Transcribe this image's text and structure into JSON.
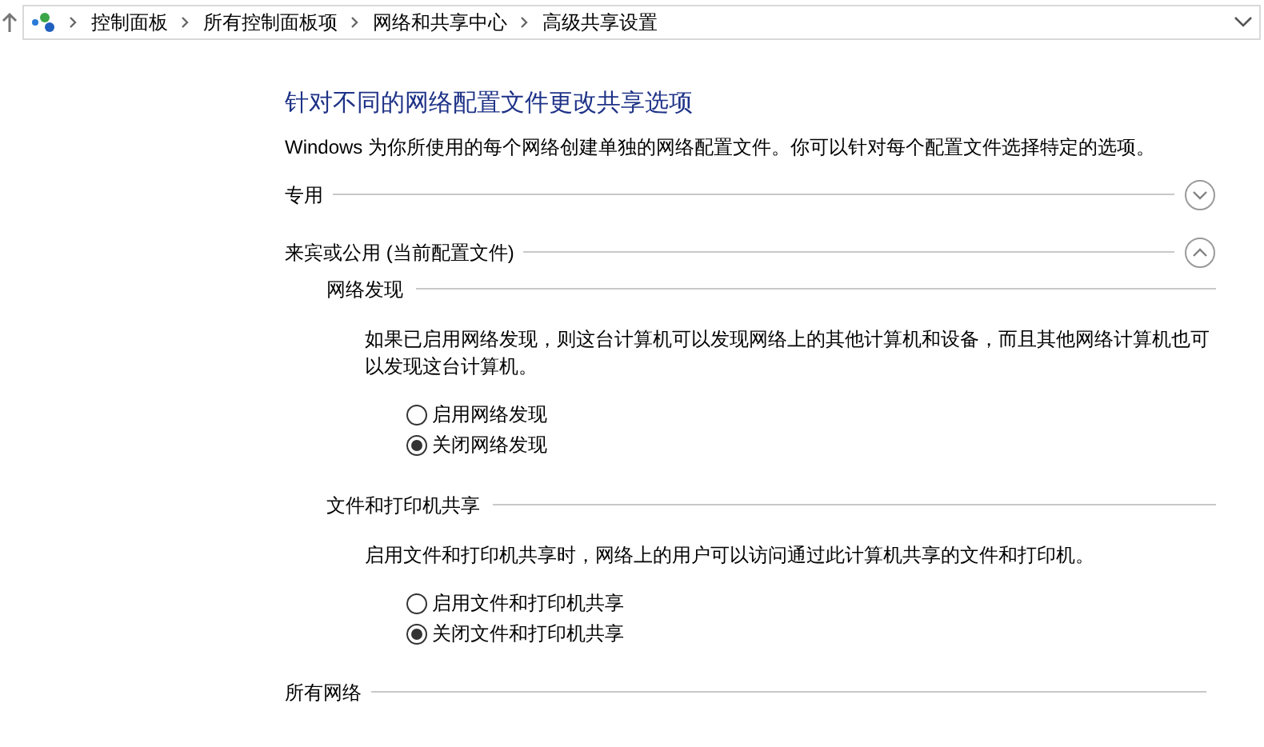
{
  "breadcrumb": [
    "控制面板",
    "所有控制面板项",
    "网络和共享中心",
    "高级共享设置"
  ],
  "title": "针对不同的网络配置文件更改共享选项",
  "description": "Windows 为你所使用的每个网络创建单独的网络配置文件。你可以针对每个配置文件选择特定的选项。",
  "profiles": [
    {
      "label": "专用",
      "expanded": false
    },
    {
      "label": "来宾或公用 (当前配置文件)",
      "expanded": true,
      "sections": [
        {
          "heading": "网络发现",
          "description": "如果已启用网络发现，则这台计算机可以发现网络上的其他计算机和设备，而且其他网络计算机也可以发现这台计算机。",
          "options": [
            {
              "label": "启用网络发现",
              "selected": false
            },
            {
              "label": "关闭网络发现",
              "selected": true
            }
          ]
        },
        {
          "heading": "文件和打印机共享",
          "description": "启用文件和打印机共享时，网络上的用户可以访问通过此计算机共享的文件和打印机。",
          "options": [
            {
              "label": "启用文件和打印机共享",
              "selected": false
            },
            {
              "label": "关闭文件和打印机共享",
              "selected": true
            }
          ]
        }
      ]
    },
    {
      "label": "所有网络"
    }
  ]
}
